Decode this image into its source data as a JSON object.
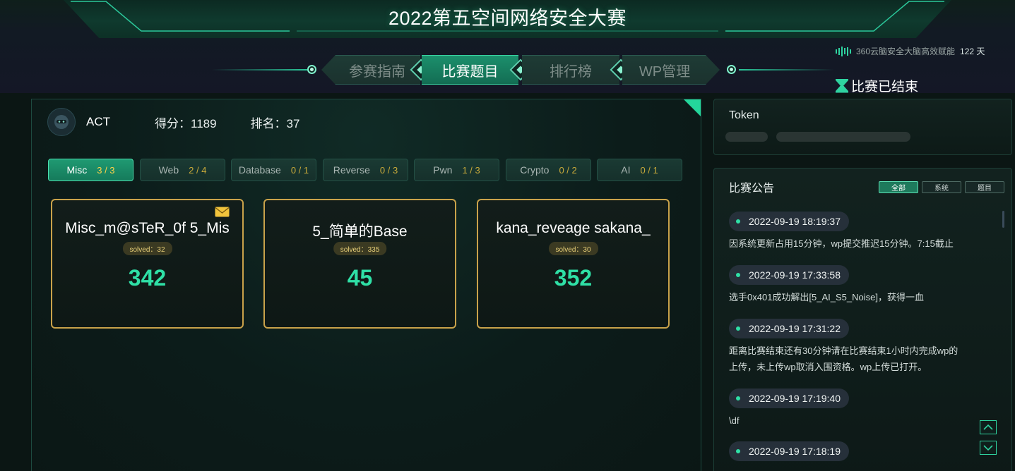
{
  "header": {
    "title": "2022第五空间网络安全大赛",
    "side_info": "360云脑安全大脑高效赋能",
    "days": "122 天",
    "status": "比赛已结束"
  },
  "nav": [
    {
      "label": "参赛指南",
      "active": false
    },
    {
      "label": "比赛题目",
      "active": true
    },
    {
      "label": "排行榜",
      "active": false
    },
    {
      "label": "WP管理",
      "active": false
    }
  ],
  "team": {
    "name": "ACT",
    "score": "得分：1189",
    "rank": "排名：37"
  },
  "categories": [
    {
      "name": "Misc",
      "count": "3 / 3",
      "active": true
    },
    {
      "name": "Web",
      "count": "2 / 4",
      "active": false
    },
    {
      "name": "Database",
      "count": "0 / 1",
      "active": false
    },
    {
      "name": "Reverse",
      "count": "0 / 3",
      "active": false
    },
    {
      "name": "Pwn",
      "count": "1 / 3",
      "active": false
    },
    {
      "name": "Crypto",
      "count": "0 / 2",
      "active": false
    },
    {
      "name": "AI",
      "count": "0 / 1",
      "active": false
    }
  ],
  "challenges": [
    {
      "title": "Misc_m@sTeR_0f 5_Mis",
      "solved": "solved：32",
      "score": "342",
      "has_mail": true
    },
    {
      "title": "5_简单的Base",
      "solved": "solved：335",
      "score": "45",
      "has_mail": false
    },
    {
      "title": "kana_reveage sakana_",
      "solved": "solved：30",
      "score": "352",
      "has_mail": false
    }
  ],
  "token": {
    "label": "Token"
  },
  "notices": {
    "title": "比赛公告",
    "filters": [
      "全部",
      "系统",
      "题目"
    ],
    "items": [
      {
        "time": "2022-09-19 18:19:37",
        "lines": [
          "因系统更新占用15分钟，wp提交推迟15分钟。7:15截止"
        ]
      },
      {
        "time": "2022-09-19 17:33:58",
        "lines": [
          "选手0x401成功解出[5_AI_S5_Noise]，获得一血"
        ]
      },
      {
        "time": "2022-09-19 17:31:22",
        "lines": [
          "距离比赛结束还有30分钟请在比赛结束1小时内完成wp的",
          "上传，未上传wp取消入围资格。wp上传已打开。"
        ]
      },
      {
        "time": "2022-09-19 17:19:40",
        "lines": [
          "\\df"
        ]
      },
      {
        "time": "2022-09-19 17:18:19",
        "lines": []
      }
    ]
  },
  "colors": {
    "accent": "#2fe0a6",
    "gold": "#c9a24a",
    "bg": "#0b1614"
  }
}
